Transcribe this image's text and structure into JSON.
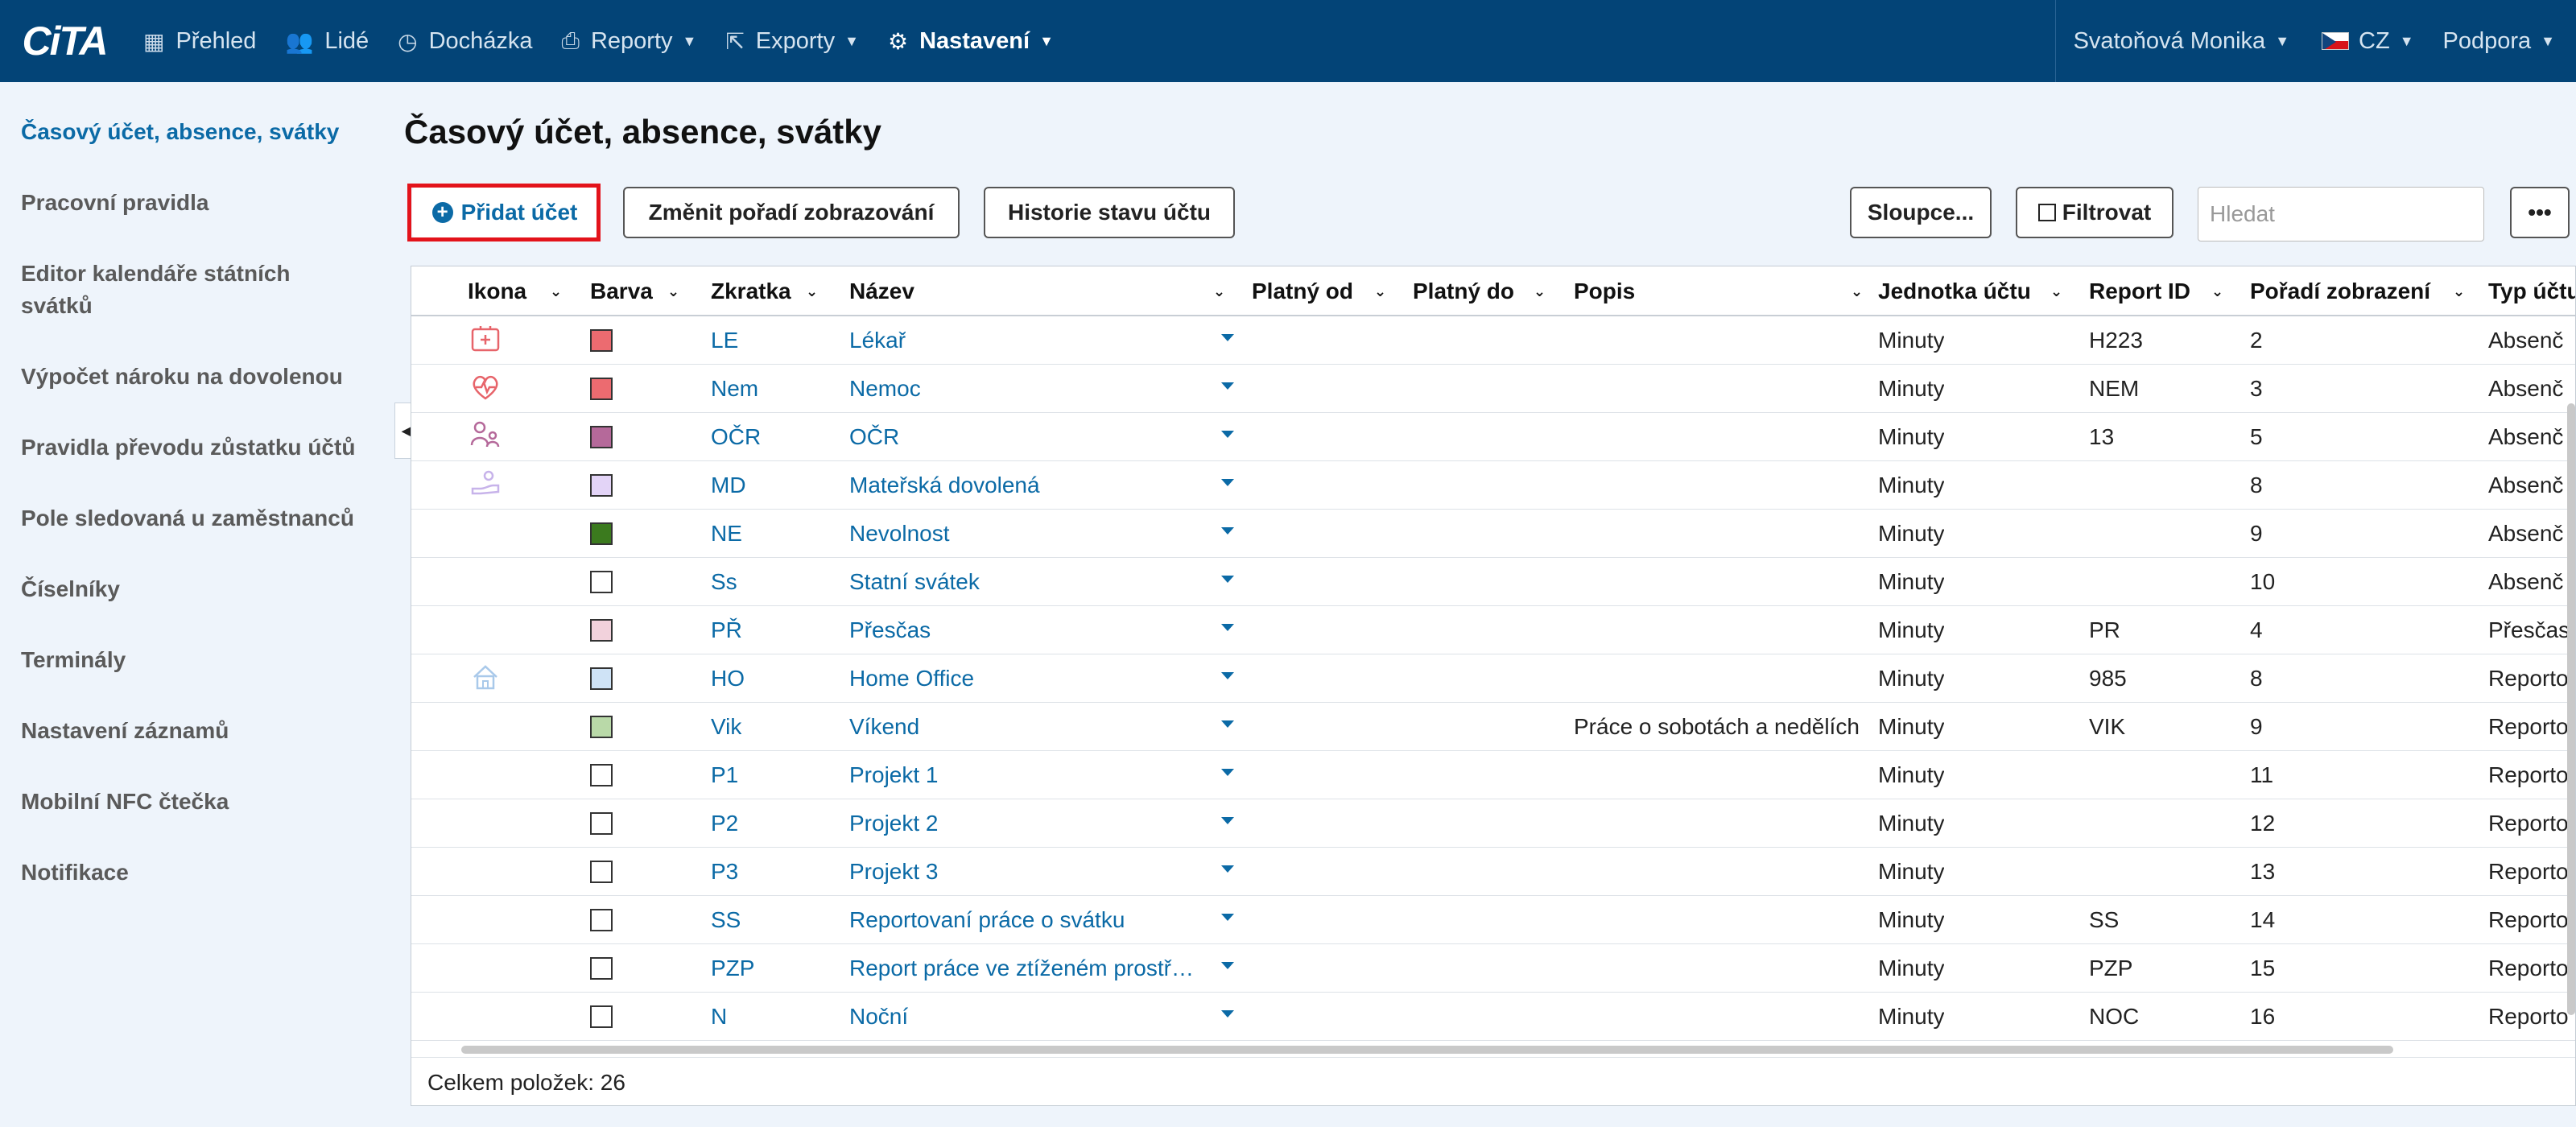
{
  "app": {
    "logo": "CiTA"
  },
  "nav": {
    "items": [
      {
        "label": "Přehled",
        "icon": "grid-icon"
      },
      {
        "label": "Lidé",
        "icon": "users-icon"
      },
      {
        "label": "Docházka",
        "icon": "clock-icon"
      },
      {
        "label": "Reporty",
        "icon": "print-icon"
      },
      {
        "label": "Exporty",
        "icon": "export-icon"
      },
      {
        "label": "Nastavení",
        "icon": "gear-icon"
      }
    ],
    "user": "Svatoňová Monika",
    "language": "CZ",
    "support": "Podpora"
  },
  "sidebar": {
    "items": [
      {
        "label": "Časový účet, absence, svátky"
      },
      {
        "label": "Pracovní pravidla"
      },
      {
        "label": "Editor kalendáře státních svátků"
      },
      {
        "label": "Výpočet nároku na dovolenou"
      },
      {
        "label": "Pravidla převodu zůstatku účtů"
      },
      {
        "label": "Pole sledovaná u zaměstnanců"
      },
      {
        "label": "Číselníky"
      },
      {
        "label": "Terminály"
      },
      {
        "label": "Nastavení záznamů"
      },
      {
        "label": "Mobilní NFC čtečka"
      },
      {
        "label": "Notifikace"
      }
    ]
  },
  "page": {
    "title": "Časový účet, absence, svátky"
  },
  "toolbar": {
    "add": "Přidat účet",
    "reorder": "Změnit pořadí zobrazování",
    "history": "Historie stavu účtu",
    "columns": "Sloupce...",
    "filter": "Filtrovat",
    "search_placeholder": "Hledat"
  },
  "table": {
    "columns": [
      "Ikona",
      "Barva",
      "Zkratka",
      "Název",
      "Platný od",
      "Platný do",
      "Popis",
      "Jednotka účtu",
      "Report ID",
      "Pořadí zobrazení",
      "Typ účtu"
    ],
    "rows": [
      {
        "icon": "medical-icon",
        "color": "#ec6b70",
        "abbr": "LE",
        "name": "Lékař",
        "from": "",
        "to": "",
        "desc": "",
        "unit": "Minuty",
        "report": "H223",
        "order": "2",
        "type": "Absenč"
      },
      {
        "icon": "heart-pulse-icon",
        "color": "#ec6b70",
        "abbr": "Nem",
        "name": "Nemoc",
        "from": "",
        "to": "",
        "desc": "",
        "unit": "Minuty",
        "report": "NEM",
        "order": "3",
        "type": "Absenč"
      },
      {
        "icon": "parent-child-icon",
        "color": "#b5699a",
        "abbr": "OČR",
        "name": "OČR",
        "from": "",
        "to": "",
        "desc": "",
        "unit": "Minuty",
        "report": "13",
        "order": "5",
        "type": "Absenč"
      },
      {
        "icon": "hand-baby-icon",
        "color": "#e3d4f7",
        "abbr": "MD",
        "name": "Mateřská dovolená",
        "from": "",
        "to": "",
        "desc": "",
        "unit": "Minuty",
        "report": "",
        "order": "8",
        "type": "Absenč"
      },
      {
        "icon": "",
        "color": "#3b7a1e",
        "abbr": "NE",
        "name": "Nevolnost",
        "from": "",
        "to": "",
        "desc": "",
        "unit": "Minuty",
        "report": "",
        "order": "9",
        "type": "Absenč"
      },
      {
        "icon": "",
        "color": "#ffffff",
        "abbr": "Ss",
        "name": "Statní svátek",
        "from": "",
        "to": "",
        "desc": "",
        "unit": "Minuty",
        "report": "",
        "order": "10",
        "type": "Absenč"
      },
      {
        "icon": "",
        "color": "#f2d2dc",
        "abbr": "PŘ",
        "name": "Přesčas",
        "from": "",
        "to": "",
        "desc": "",
        "unit": "Minuty",
        "report": "PR",
        "order": "4",
        "type": "Přesčas"
      },
      {
        "icon": "home-icon",
        "color": "#cfe3f6",
        "abbr": "HO",
        "name": "Home Office",
        "from": "",
        "to": "",
        "desc": "",
        "unit": "Minuty",
        "report": "985",
        "order": "8",
        "type": "Reporto"
      },
      {
        "icon": "",
        "color": "#b9d9a8",
        "abbr": "Vik",
        "name": "Víkend",
        "from": "",
        "to": "",
        "desc": "Práce o sobotách a nedělích",
        "unit": "Minuty",
        "report": "VIK",
        "order": "9",
        "type": "Reporto"
      },
      {
        "icon": "",
        "color": "#ffffff",
        "abbr": "P1",
        "name": "Projekt 1",
        "from": "",
        "to": "",
        "desc": "",
        "unit": "Minuty",
        "report": "",
        "order": "11",
        "type": "Reporto"
      },
      {
        "icon": "",
        "color": "#ffffff",
        "abbr": "P2",
        "name": "Projekt 2",
        "from": "",
        "to": "",
        "desc": "",
        "unit": "Minuty",
        "report": "",
        "order": "12",
        "type": "Reporto"
      },
      {
        "icon": "",
        "color": "#ffffff",
        "abbr": "P3",
        "name": "Projekt 3",
        "from": "",
        "to": "",
        "desc": "",
        "unit": "Minuty",
        "report": "",
        "order": "13",
        "type": "Reporto"
      },
      {
        "icon": "",
        "color": "#ffffff",
        "abbr": "SS",
        "name": "Reportovaní práce o svátku",
        "from": "",
        "to": "",
        "desc": "",
        "unit": "Minuty",
        "report": "SS",
        "order": "14",
        "type": "Reporto"
      },
      {
        "icon": "",
        "color": "#ffffff",
        "abbr": "PZP",
        "name": "Report práce ve ztíženém prostř…",
        "from": "",
        "to": "",
        "desc": "",
        "unit": "Minuty",
        "report": "PZP",
        "order": "15",
        "type": "Reporto"
      },
      {
        "icon": "",
        "color": "#ffffff",
        "abbr": "N",
        "name": "Noční",
        "from": "",
        "to": "",
        "desc": "",
        "unit": "Minuty",
        "report": "NOC",
        "order": "16",
        "type": "Reporto"
      }
    ],
    "footer": "Celkem položek: 26"
  }
}
